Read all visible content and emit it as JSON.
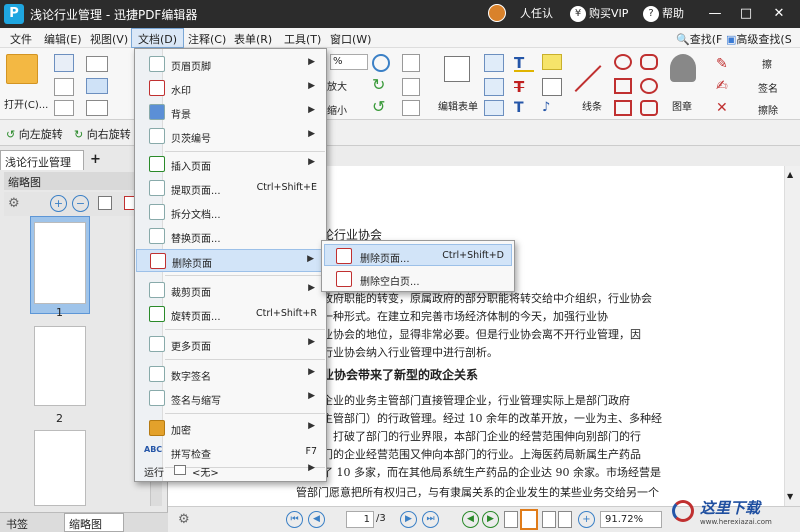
{
  "titlebar": {
    "logo": "P",
    "title": "浅论行业管理 - 迅捷PDF编辑器",
    "user": "人任认",
    "vip": "购买VIP",
    "help": "帮助",
    "minimize": "—",
    "maximize": "□",
    "close": "✕"
  },
  "menubar": {
    "items": [
      "文件",
      "编辑(E)",
      "视图(V)",
      "文档(D)",
      "注释(C)",
      "表单(R)",
      "工具(T)",
      "窗口(W)"
    ],
    "find": "查找(F",
    "advanced_find": "高级查找(S"
  },
  "ribbon": {
    "open": "打开(C)...",
    "zoom_value": "%",
    "zoom_label": "放大",
    "zoom_small": "缩小",
    "edit_form": "编辑表单",
    "line": "线条",
    "stamp": "图章",
    "sign": "签名",
    "wipe": "擦除",
    "erase_row": "擦"
  },
  "rowbar": {
    "rotate_left": "向左旋转",
    "rotate_right": "向右旋转"
  },
  "leftpanel": {
    "doc_tab": "浅论行业管理",
    "thumb_header": "缩略图",
    "page1": "1",
    "page2": "2",
    "tab_bookmarks": "书签",
    "tab_thumbs": "缩略图"
  },
  "document": {
    "heading1": "论行业协会",
    "para1": [
      "政府职能的转变，原属政府的部分职能将转交给中介组织，行业协会",
      "一种形式。在建立和完善市场经济体制的今天，加强行业协",
      "业协会的地位，显得非常必要。但是行业协会离不开行业管理，因",
      "行业协会纳入行业管理中进行剖析。"
    ],
    "heading2": "业协会带来了新型的政企关系",
    "para2": [
      "企业的业务主管部门直接管理企业，行业管理实际上是部门政府",
      "主管部门）的行政管理。经过 10 余年的改革开放，一业为主、多种经",
      "，打破了部门的行业界限，本部门企业的经营范围伸向别部门的行",
      "门的企业经营范围又伸向本部门的行业。上海医药局新属生产药品",
      "了 10 多家，而在其他局系统生产药品的企业达 90 余家。市场经营是",
      "管部门愿意把所有权归己，与有隶属关系的企业发生的某些业务交给另一个"
    ]
  },
  "menu": {
    "items": [
      {
        "label": "页眉页脚",
        "shortcut": "",
        "arrow": "▶"
      },
      {
        "label": "水印",
        "shortcut": "",
        "arrow": "▶"
      },
      {
        "label": "背景",
        "shortcut": "",
        "arrow": "▶"
      },
      {
        "label": "贝茨编号",
        "shortcut": "",
        "arrow": "▶"
      },
      {
        "label": "插入页面",
        "shortcut": "",
        "arrow": "▶"
      },
      {
        "label": "提取页面...",
        "shortcut": "Ctrl+Shift+E",
        "arrow": ""
      },
      {
        "label": "拆分文档...",
        "shortcut": "",
        "arrow": ""
      },
      {
        "label": "替换页面...",
        "shortcut": "",
        "arrow": ""
      },
      {
        "label": "删除页面",
        "shortcut": "",
        "arrow": "▶"
      },
      {
        "label": "裁剪页面",
        "shortcut": "",
        "arrow": "▶"
      },
      {
        "label": "旋转页面...",
        "shortcut": "Ctrl+Shift+R",
        "arrow": ""
      },
      {
        "label": "更多页面",
        "shortcut": "",
        "arrow": "▶"
      },
      {
        "label": "数字签名",
        "shortcut": "",
        "arrow": "▶"
      },
      {
        "label": "签名与缩写",
        "shortcut": "",
        "arrow": "▶"
      },
      {
        "label": "加密",
        "shortcut": "",
        "arrow": "▶"
      },
      {
        "label": "拼写检查",
        "shortcut": "F7",
        "arrow": ""
      },
      {
        "label": "运行",
        "shortcut": "",
        "arrow": "▶"
      }
    ],
    "run_value": "<无>",
    "abc": "ABC"
  },
  "submenu": {
    "items": [
      {
        "label": "删除页面...",
        "shortcut": "Ctrl+Shift+D"
      },
      {
        "label": "删除空白页..."
      }
    ]
  },
  "statusbar": {
    "page_input": "1",
    "page_total": "/3",
    "zoom": "91.72%"
  },
  "watermark": {
    "text": "这里下载",
    "url": "www.herexiazai.com"
  },
  "colors": {
    "titlebar": "#2c2c2c",
    "accent": "#1fa6e0",
    "menu_highlight": "#d2e4f8",
    "thumb_selected": "#9fc4ea"
  }
}
